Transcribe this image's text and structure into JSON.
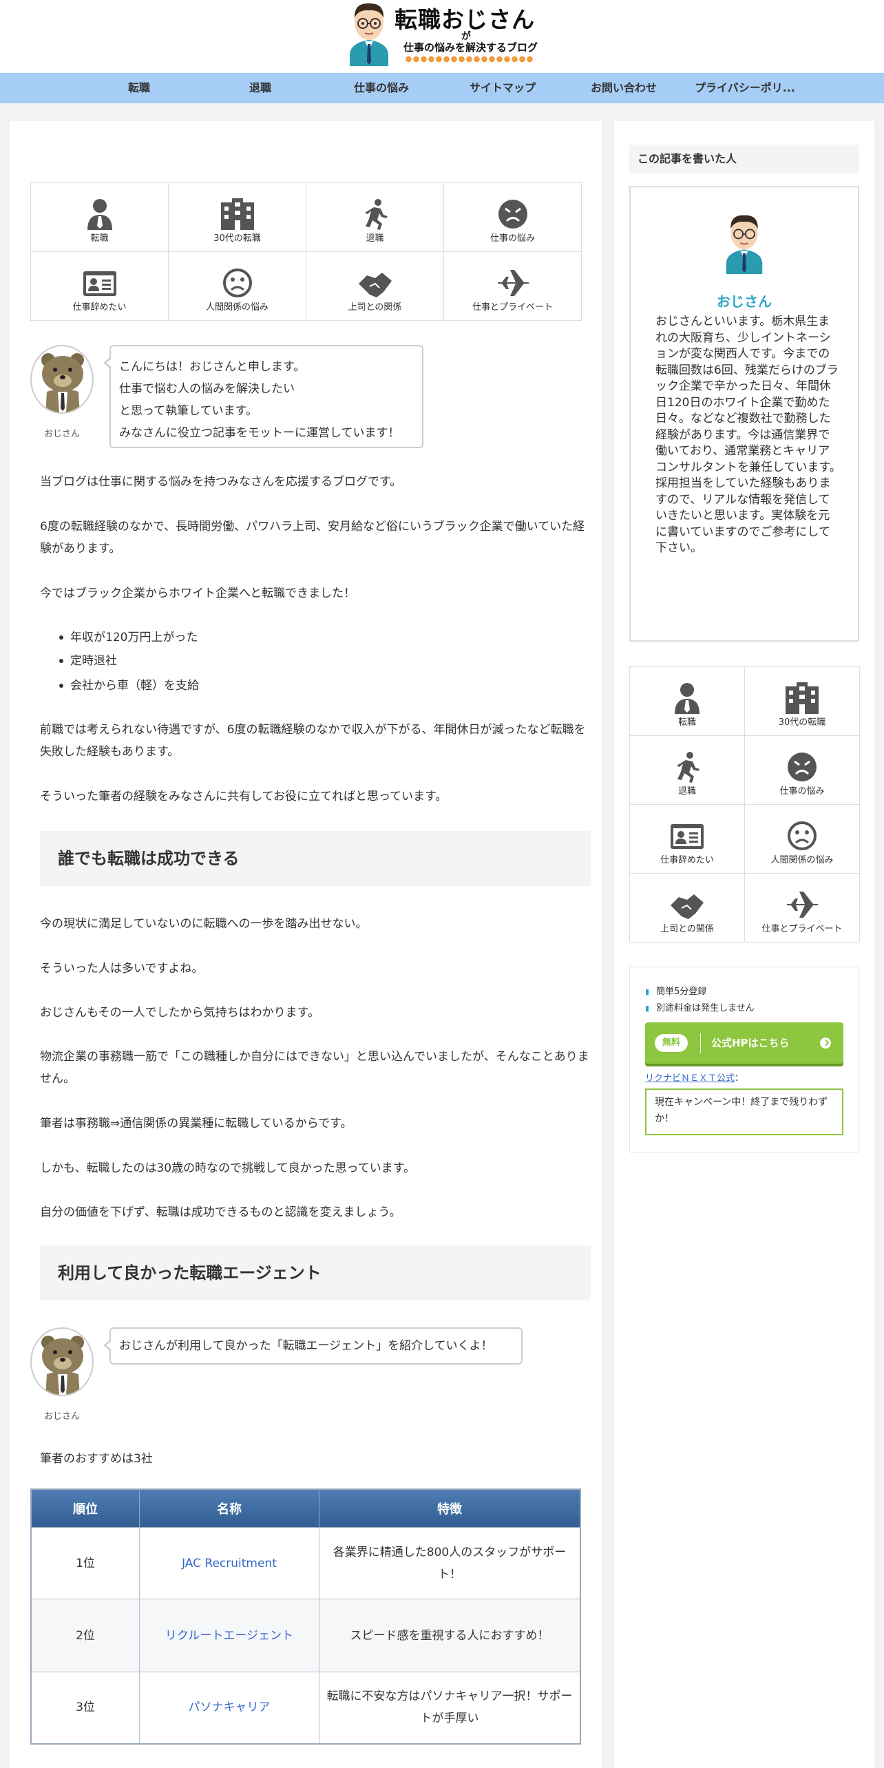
{
  "site": {
    "title": "転職おじさん",
    "ga": "が",
    "subtitle": "仕事の悩みを解決するブログ"
  },
  "nav": [
    "転職",
    "退職",
    "仕事の悩み",
    "サイトマップ",
    "お問い合わせ",
    "プライバシーポリ..."
  ],
  "categories": [
    {
      "label": "転職",
      "icon": "person-icon"
    },
    {
      "label": "30代の転職",
      "icon": "building-icon"
    },
    {
      "label": "退職",
      "icon": "running-icon"
    },
    {
      "label": "仕事の悩み",
      "icon": "angry-face-icon"
    },
    {
      "label": "仕事辞めたい",
      "icon": "id-card-icon"
    },
    {
      "label": "人間関係の悩み",
      "icon": "sad-face-icon"
    },
    {
      "label": "上司との関係",
      "icon": "handshake-icon"
    },
    {
      "label": "仕事とプライベート",
      "icon": "airplane-icon"
    }
  ],
  "intro_speech": {
    "name": "おじさん",
    "lines": [
      "こんにちは！おじさんと申します。",
      "仕事で悩む人の悩みを解決したい",
      "と思って執筆しています。",
      "みなさんに役立つ記事をモットーに運営しています！"
    ]
  },
  "body": {
    "p1": "当ブログは仕事に関する悩みを持つみなさんを応援するブログです。",
    "p2": "6度の転職経験のなかで、長時間労働、パワハラ上司、安月給など俗にいうブラック企業で働いていた経験があります。",
    "p3": "今ではブラック企業からホワイト企業へと転職できました！",
    "list": [
      "年収が120万円上がった",
      "定時退社",
      "会社から車（軽）を支給"
    ],
    "p4": "前職では考えられない待遇ですが、6度の転職経験のなかで収入が下がる、年間休日が減ったなど転職を失敗した経験もあります。",
    "p5": "そういった筆者の経験をみなさんに共有してお役に立てればと思っています。",
    "h2a": "誰でも転職は成功できる",
    "p6": "今の現状に満足していないのに転職への一歩を踏み出せない。",
    "p7": "そういった人は多いですよね。",
    "p8": "おじさんもその一人でしたから気持ちはわかります。",
    "p9": "物流企業の事務職一筋で「この職種しか自分にはできない」と思い込んでいましたが、そんなことありません。",
    "p10": "筆者は事務職⇒通信関係の異業種に転職しているからです。",
    "p11": "しかも、転職したのは30歳の時なので挑戦して良かった思っています。",
    "p12": "自分の価値を下げず、転職は成功できるものと認識を変えましょう。",
    "h2b": "利用して良かった転職エージェント",
    "speech2": "おじさんが利用して良かった「転職エージェント」を紹介していくよ！",
    "speech2_name": "おじさん",
    "p13": "筆者のおすすめは3社"
  },
  "table": {
    "headers": [
      "順位",
      "名称",
      "特徴"
    ],
    "rows": [
      {
        "rank": "1位",
        "name": "JAC Recruitment",
        "feature": "各業界に精通した800人のスタッフがサポート！"
      },
      {
        "rank": "2位",
        "name": "リクルートエージェント",
        "feature": "スピード感を重視する人におすすめ！"
      },
      {
        "rank": "3位",
        "name": "パソナキャリア",
        "feature": "転職に不安な方はパソナキャリア一択！サポートが手厚い"
      }
    ]
  },
  "sidebar": {
    "profile_title": "この記事を書いた人",
    "name": "おじさん",
    "bio": "おじさんといいます。栃木県生まれの大阪育ち、少しイントネーションが変な関西人です。今までの転職回数は6回、残業だらけのブラック企業で辛かった日々、年間休日120日のホワイト企業で勤めた日々。などなど複数社で勤務した経験があります。今は通信業界で働いており、通常業務とキャリアコンサルタントを兼任しています。採用担当をしていた経験もありますので、リアルな情報を発信していきたいと思います。実体験を元に書いていますのでご参考にして下さい。",
    "checks": [
      "簡単5分登録",
      "別途料金は発生しません"
    ],
    "cta_free": "無料",
    "cta_label": "公式HPはこちら",
    "rk_link": "リクナビＮＥＸＴ公式",
    "rk_suffix": "：",
    "campaign": "現在キャンペーン中！終了まで残りわずか！"
  }
}
